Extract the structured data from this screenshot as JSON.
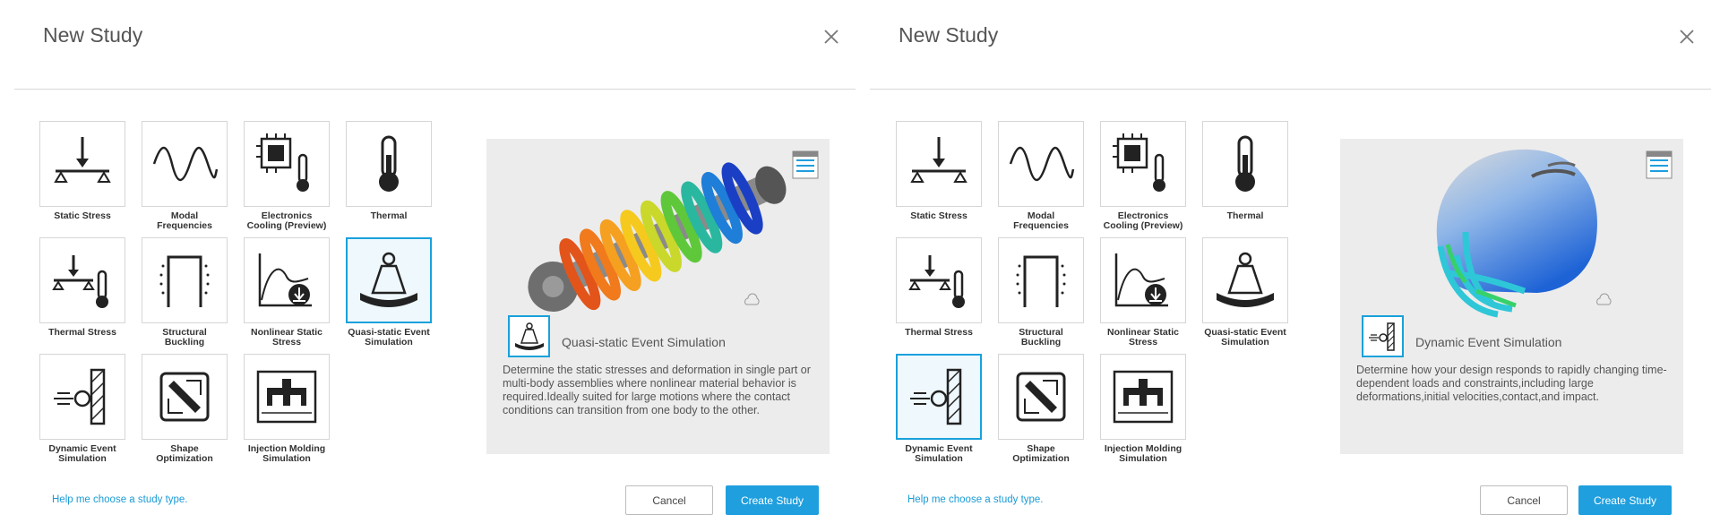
{
  "dialogs": [
    {
      "title": "New Study",
      "tiles": [
        {
          "label": "Static Stress",
          "icon": "static-stress-icon"
        },
        {
          "label": "Modal Frequencies",
          "icon": "modal-frequencies-icon"
        },
        {
          "label": "Electronics Cooling (Preview)",
          "icon": "electronics-cooling-icon"
        },
        {
          "label": "Thermal",
          "icon": "thermal-icon"
        },
        {
          "label": "Thermal Stress",
          "icon": "thermal-stress-icon"
        },
        {
          "label": "Structural Buckling",
          "icon": "structural-buckling-icon"
        },
        {
          "label": "Nonlinear Static Stress",
          "icon": "nonlinear-static-stress-icon"
        },
        {
          "label": "Quasi-static Event Simulation",
          "icon": "quasi-static-event-icon"
        },
        {
          "label": "Dynamic Event Simulation",
          "icon": "dynamic-event-icon"
        },
        {
          "label": "Shape Optimization",
          "icon": "shape-optimization-icon"
        },
        {
          "label": "Injection Molding Simulation",
          "icon": "injection-molding-icon"
        }
      ],
      "selected_index": 7,
      "preview": {
        "image": "shock-absorber-spring-image",
        "title": "Quasi-static Event Simulation",
        "description": "Determine the static stresses and deformation in single part or multi-body assemblies where nonlinear material behavior is required.Ideally suited for large motions where the contact conditions can transition from one body to the other."
      },
      "help_link": "Help me choose a study type.",
      "cancel_label": "Cancel",
      "create_label": "Create Study"
    },
    {
      "title": "New Study",
      "tiles": [
        {
          "label": "Static Stress",
          "icon": "static-stress-icon"
        },
        {
          "label": "Modal Frequencies",
          "icon": "modal-frequencies-icon"
        },
        {
          "label": "Electronics Cooling (Preview)",
          "icon": "electronics-cooling-icon"
        },
        {
          "label": "Thermal",
          "icon": "thermal-icon"
        },
        {
          "label": "Thermal Stress",
          "icon": "thermal-stress-icon"
        },
        {
          "label": "Structural Buckling",
          "icon": "structural-buckling-icon"
        },
        {
          "label": "Nonlinear Static Stress",
          "icon": "nonlinear-static-stress-icon"
        },
        {
          "label": "Quasi-static Event Simulation",
          "icon": "quasi-static-event-icon"
        },
        {
          "label": "Dynamic Event Simulation",
          "icon": "dynamic-event-icon"
        },
        {
          "label": "Shape Optimization",
          "icon": "shape-optimization-icon"
        },
        {
          "label": "Injection Molding Simulation",
          "icon": "injection-molding-icon"
        }
      ],
      "selected_index": 8,
      "preview": {
        "image": "helmet-image",
        "title": "Dynamic Event Simulation",
        "description": "Determine how your design responds to rapidly changing time-dependent loads and constraints,including large deformations,initial velocities,contact,and impact."
      },
      "help_link": "Help me choose a study type.",
      "cancel_label": "Cancel",
      "create_label": "Create Study"
    }
  ],
  "colors": {
    "accent": "#1f9fde",
    "selected_border": "#19a1dc",
    "preview_bg": "#ececec"
  }
}
